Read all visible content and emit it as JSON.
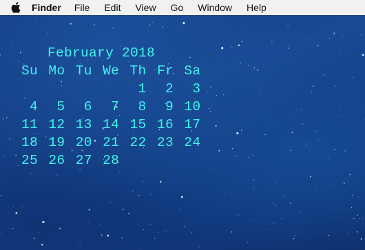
{
  "menubar": {
    "apple_icon": "apple-icon",
    "items": [
      "Finder",
      "File",
      "Edit",
      "View",
      "Go",
      "Window",
      "Help"
    ]
  },
  "calendar": {
    "title": "February 2018",
    "weekdays": [
      "Su",
      "Mo",
      "Tu",
      "We",
      "Th",
      "Fr",
      "Sa"
    ],
    "weeks": [
      [
        "",
        "",
        "",
        "",
        "1",
        "2",
        "3"
      ],
      [
        "4",
        "5",
        "6",
        "7",
        "8",
        "9",
        "10"
      ],
      [
        "11",
        "12",
        "13",
        "14",
        "15",
        "16",
        "17"
      ],
      [
        "18",
        "19",
        "20",
        "21",
        "22",
        "23",
        "24"
      ],
      [
        "25",
        "26",
        "27",
        "28",
        "",
        "",
        ""
      ]
    ]
  },
  "colors": {
    "calendar_text": "#3ff5ec",
    "menubar_bg": "#f1f1f1",
    "desktop_bg": "#1a4a95"
  }
}
